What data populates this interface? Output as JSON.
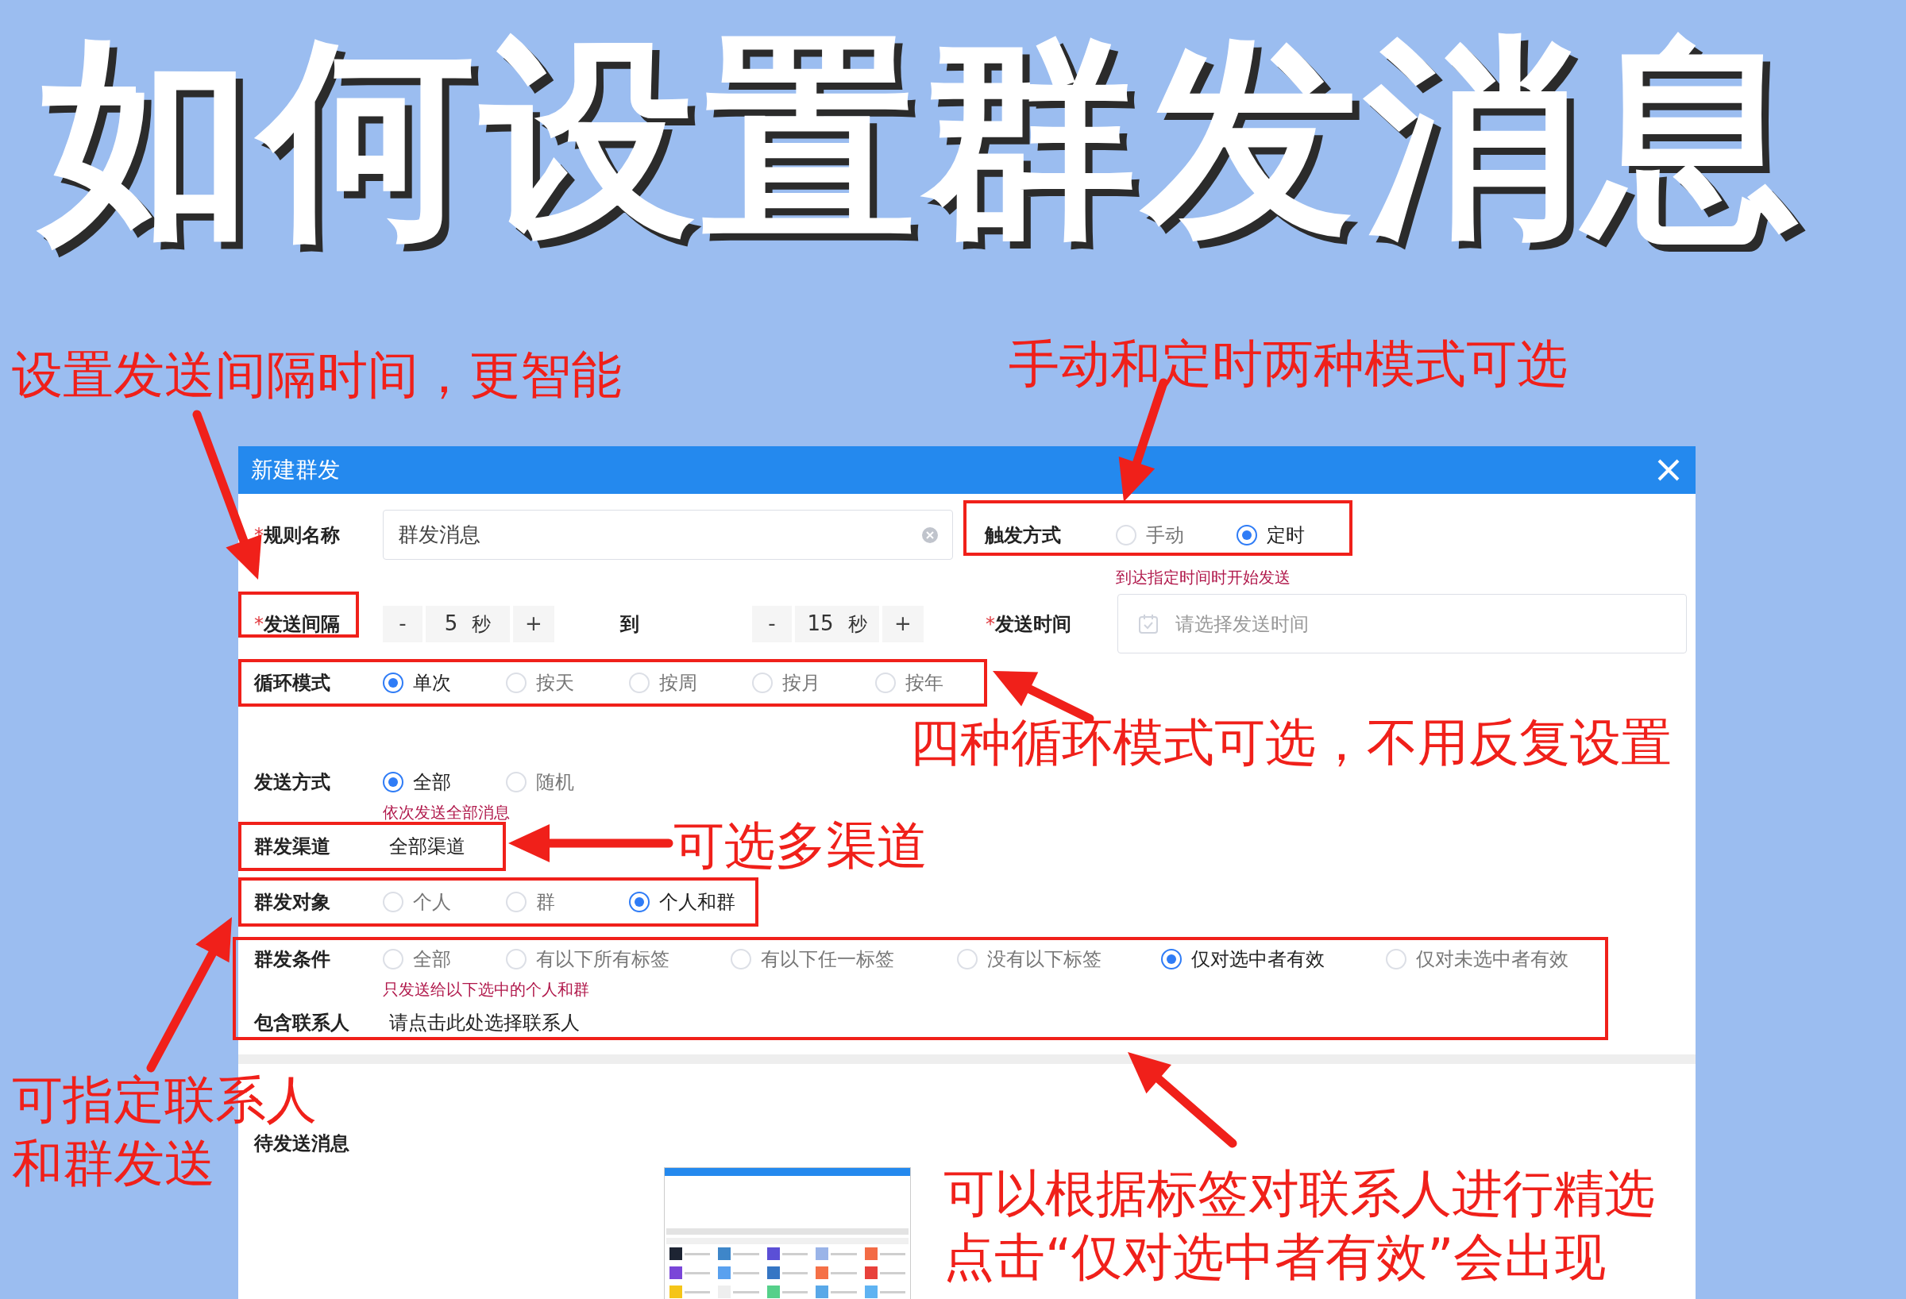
{
  "poster_title": "如何设置群发消息",
  "dialog": {
    "title": "新建群发",
    "rule_name": {
      "required_mark": "*",
      "label": "规则名称",
      "value": "群发消息"
    },
    "trigger": {
      "label": "触发方式",
      "options": [
        {
          "label": "手动",
          "selected": false
        },
        {
          "label": "定时",
          "selected": true
        }
      ],
      "hint": "到达指定时间时开始发送"
    },
    "interval": {
      "required_mark": "*",
      "label": "发送间隔",
      "from": {
        "minus": "-",
        "value": "5",
        "unit": "秒",
        "plus": "+"
      },
      "to_label": "到",
      "to": {
        "minus": "-",
        "value": "15",
        "unit": "秒",
        "plus": "+"
      }
    },
    "send_time": {
      "required_mark": "*",
      "label": "发送时间",
      "placeholder": "请选择发送时间"
    },
    "loop_mode": {
      "label": "循环模式",
      "options": [
        {
          "label": "单次",
          "selected": true
        },
        {
          "label": "按天",
          "selected": false
        },
        {
          "label": "按周",
          "selected": false
        },
        {
          "label": "按月",
          "selected": false
        },
        {
          "label": "按年",
          "selected": false
        }
      ]
    },
    "send_method": {
      "label": "发送方式",
      "options": [
        {
          "label": "全部",
          "selected": true
        },
        {
          "label": "随机",
          "selected": false
        }
      ],
      "hint": "依次发送全部消息"
    },
    "channel": {
      "label": "群发渠道",
      "value": "全部渠道"
    },
    "target": {
      "label": "群发对象",
      "options": [
        {
          "label": "个人",
          "selected": false
        },
        {
          "label": "群",
          "selected": false
        },
        {
          "label": "个人和群",
          "selected": true
        }
      ]
    },
    "condition": {
      "label": "群发条件",
      "options": [
        {
          "label": "全部",
          "selected": false
        },
        {
          "label": "有以下所有标签",
          "selected": false
        },
        {
          "label": "有以下任一标签",
          "selected": false
        },
        {
          "label": "没有以下标签",
          "selected": false
        },
        {
          "label": "仅对选中者有效",
          "selected": true
        },
        {
          "label": "仅对未选中者有效",
          "selected": false
        }
      ],
      "hint": "只发送给以下选中的个人和群"
    },
    "contacts": {
      "label": "包含联系人",
      "value": "请点击此处选择联系人"
    },
    "pending": {
      "label": "待发送消息"
    }
  },
  "annotations": [
    {
      "lines": [
        "设置发送间隔时间，更智能"
      ]
    },
    {
      "lines": [
        "手动和定时两种模式可选"
      ]
    },
    {
      "lines": [
        "四种循环模式可选，不用反复设置"
      ]
    },
    {
      "lines": [
        "可选多渠道"
      ]
    },
    {
      "lines": [
        "可指定联系人",
        "和群发送"
      ]
    },
    {
      "lines": [
        "可以根据标签对联系人进行精选",
        "点击“仅对选中者有效”会出现"
      ]
    }
  ]
}
